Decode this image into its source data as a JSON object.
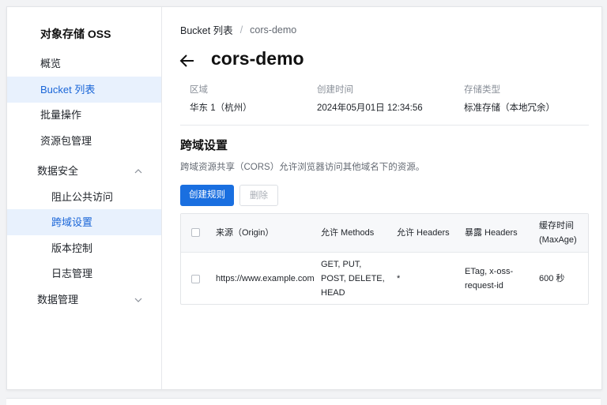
{
  "sidebar": {
    "brand": "对象存储 OSS",
    "items": [
      {
        "label": "概览"
      },
      {
        "label": "Bucket 列表"
      },
      {
        "label": "批量操作"
      },
      {
        "label": "资源包管理"
      },
      {
        "label": "数据安全"
      },
      {
        "label": "阻止公共访问"
      },
      {
        "label": "跨域设置"
      },
      {
        "label": "版本控制"
      },
      {
        "label": "日志管理"
      },
      {
        "label": "数据管理"
      }
    ],
    "active_color": "#1a66d8"
  },
  "breadcrumb": {
    "root": "Bucket 列表",
    "separator": "/",
    "current": "cors-demo"
  },
  "header": {
    "back_icon": "arrow-left-icon",
    "title": "cors-demo"
  },
  "meta": {
    "region_label": "区域",
    "region_value": "华东 1（杭州）",
    "created_label": "创建时间",
    "created_value": "2024年05月01日 12:34:56",
    "storage_label": "存储类型",
    "storage_value": "标准存储（本地冗余）"
  },
  "section": {
    "title": "跨域设置",
    "description": "跨域资源共享（CORS）允许浏览器访问其他域名下的资源。"
  },
  "actions": {
    "create_label": "创建规则",
    "delete_label": "删除",
    "primary_color": "#1a6fe0"
  },
  "table": {
    "headers": {
      "origin": "来源（Origin）",
      "methods": "允许 Methods",
      "headers": "允许 Headers",
      "expose_line1": "暴露 Headers",
      "maxage_line1": "缓存时间",
      "maxage_line2": "(MaxAge)"
    },
    "rows": [
      {
        "origin": "https://www.example.com",
        "methods_line1": "GET, PUT,",
        "methods_line2": "POST, DELETE,",
        "methods_line3": "HEAD",
        "headers": "*",
        "expose_line1": "ETag, x-oss-",
        "expose_line2": "request-id",
        "maxage": "600 秒"
      }
    ]
  }
}
